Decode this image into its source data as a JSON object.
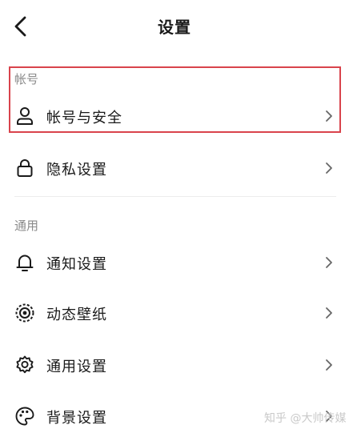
{
  "header": {
    "title": "设置",
    "back_icon": "chevron-left-icon"
  },
  "sections": [
    {
      "title": "帐号",
      "items": [
        {
          "label": "帐号与安全",
          "icon": "user-icon"
        },
        {
          "label": "隐私设置",
          "icon": "lock-icon"
        }
      ]
    },
    {
      "title": "通用",
      "items": [
        {
          "label": "通知设置",
          "icon": "bell-icon"
        },
        {
          "label": "动态壁纸",
          "icon": "live-wallpaper-icon"
        },
        {
          "label": "通用设置",
          "icon": "gear-icon"
        },
        {
          "label": "背景设置",
          "icon": "palette-icon"
        }
      ]
    }
  ],
  "highlight_color": "#d9434c",
  "watermark": "知乎 @大帅传媒"
}
